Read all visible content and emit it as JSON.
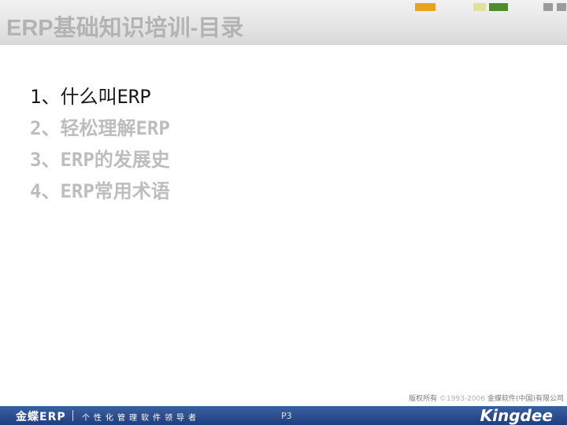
{
  "slide": {
    "title": "ERP基础知识培训-目录"
  },
  "toc": {
    "items": [
      {
        "label": "1、什么叫ERP",
        "active": true
      },
      {
        "label": "2、轻松理解ERP",
        "active": false
      },
      {
        "label": "3、ERP的发展史",
        "active": false
      },
      {
        "label": "4、ERP常用术语",
        "active": false
      }
    ]
  },
  "copyright": {
    "prefix": "版权所有 ",
    "years": "©1993-2006",
    "owner": " 金蝶软件(中国)有限公司"
  },
  "footer": {
    "brand": "金蝶ERP",
    "slogan": "个性化管理软件领导者",
    "page": "P3",
    "logo": "Kingdee"
  },
  "colors": {
    "footer_bar": "#1f3f7e",
    "title_text": "#b3b3b3",
    "active_item": "#1a1a1a",
    "inactive_item": "#bdbdbd",
    "accent_orange": "#e8a41e",
    "accent_green": "#4f8a2e"
  }
}
